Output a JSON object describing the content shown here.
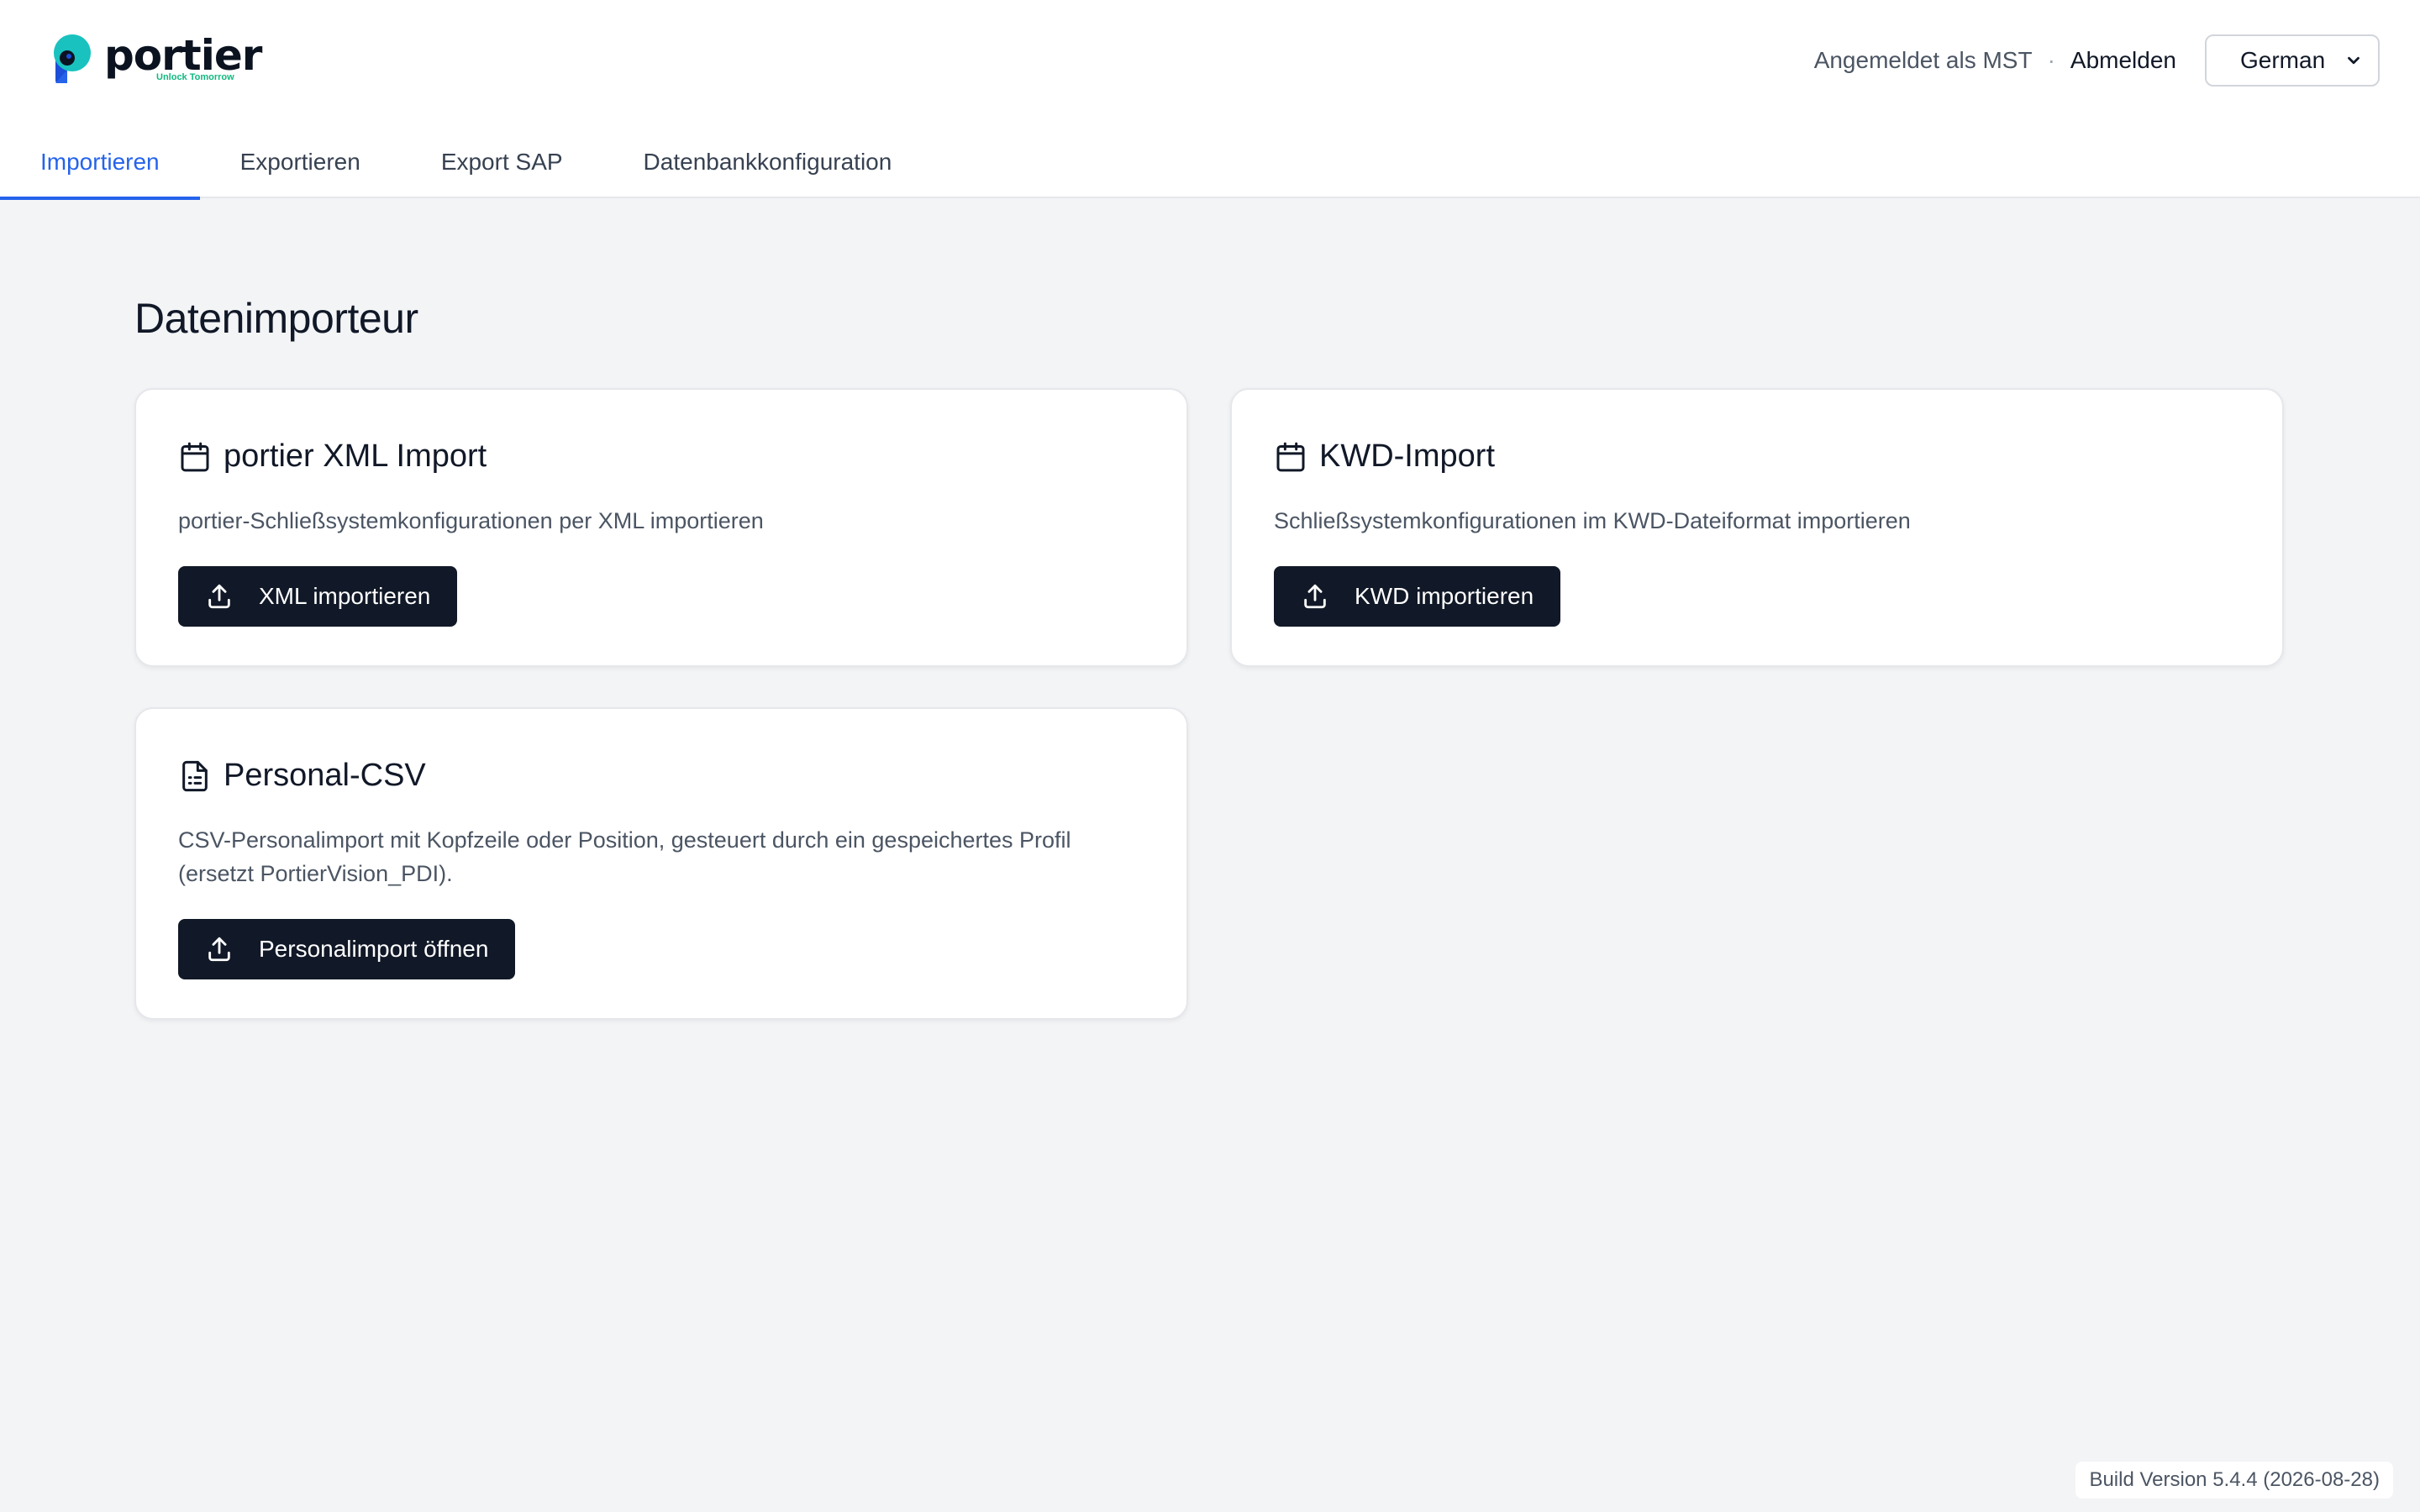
{
  "brand": {
    "name": "portier",
    "tagline": "Unlock Tomorrow",
    "colors": {
      "primary": "#0b1320",
      "accent_teal": "#14b8a6",
      "accent_blue": "#2563eb",
      "tagline": "#10b981"
    }
  },
  "header": {
    "user_label": "Angemeldet als MST",
    "separator": "·",
    "logout_label": "Abmelden",
    "language": {
      "selected": "German"
    }
  },
  "tabs": [
    {
      "label": "Importieren",
      "active": true
    },
    {
      "label": "Exportieren",
      "active": false
    },
    {
      "label": "Export SAP",
      "active": false
    },
    {
      "label": "Datenbankkonfiguration",
      "active": false
    }
  ],
  "main": {
    "title": "Datenimporteur",
    "cards": [
      {
        "icon": "calendar-icon",
        "title": "portier XML Import",
        "description": "portier-Schließsystemkonfigurationen per XML importieren",
        "button": {
          "icon": "upload-icon",
          "label": "XML importieren"
        }
      },
      {
        "icon": "calendar-icon",
        "title": "KWD-Import",
        "description": "Schließsystemkonfigurationen im KWD-Dateiformat importieren",
        "button": {
          "icon": "upload-icon",
          "label": "KWD importieren"
        }
      },
      {
        "icon": "file-text-icon",
        "title": "Personal-CSV",
        "description": "CSV-Personalimport mit Kopfzeile oder Position, gesteuert durch ein gespeichertes Profil (ersetzt PortierVision_PDI).",
        "button": {
          "icon": "upload-icon",
          "label": "Personalimport öffnen"
        }
      }
    ]
  },
  "footer": {
    "build": "Build Version 5.4.4 (2026-08-28)"
  }
}
